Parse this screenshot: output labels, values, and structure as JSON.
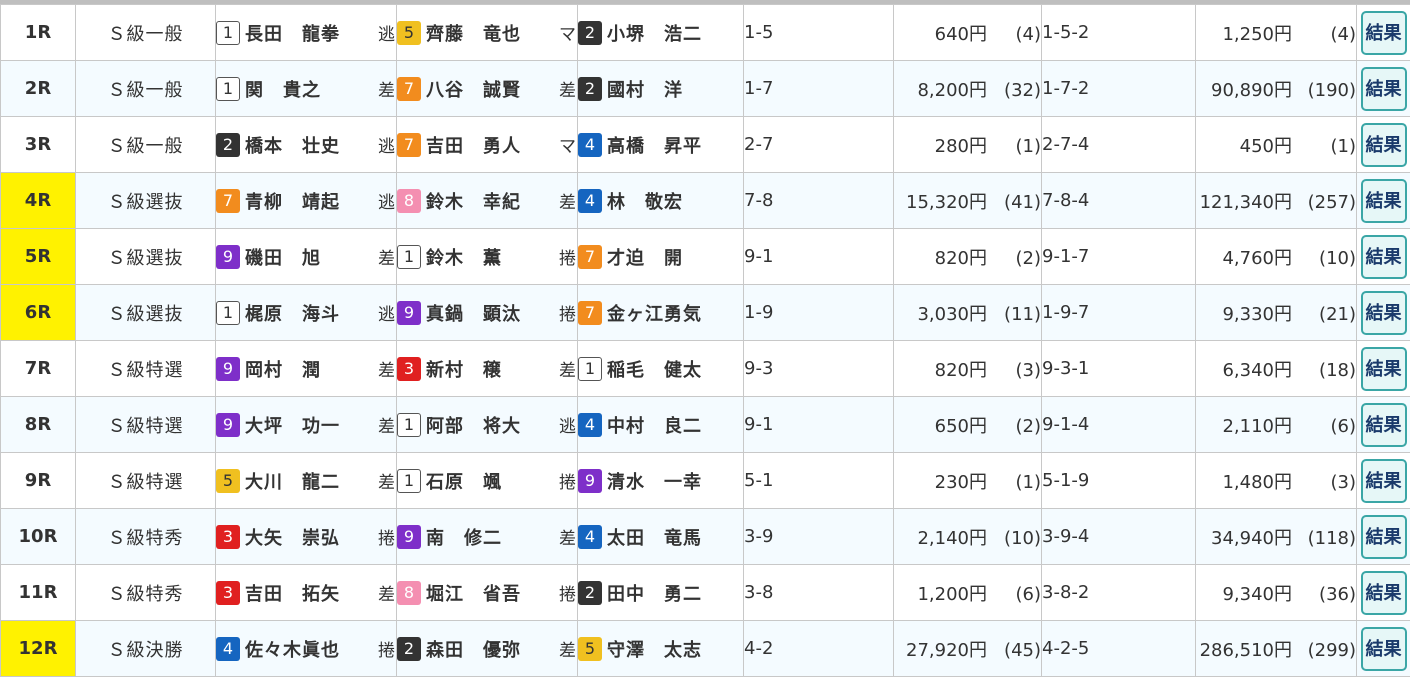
{
  "button_label": "結果",
  "car_colors": {
    "1": "#ffffff",
    "2": "#333333",
    "3": "#e02020",
    "4": "#1565c0",
    "5": "#f0c020",
    "6": "#2e7d32",
    "7": "#f28c1e",
    "8": "#f48fb1",
    "9": "#7e2fc9"
  },
  "highlight_color": "#fff200",
  "races": [
    {
      "race": "1R",
      "highlight": false,
      "grade": "Ｓ級一般",
      "first": {
        "car": "1",
        "name": "長田　龍拳",
        "tactic": "逃"
      },
      "second": {
        "car": "5",
        "name": "齊藤　竜也",
        "tactic": "マ"
      },
      "third": {
        "car": "2",
        "name": "小堺　浩二"
      },
      "exacta": "1-5",
      "exacta_pay": "640円",
      "exacta_pop": "(4)",
      "trifecta": "1-5-2",
      "trifecta_pay": "1,250円",
      "trifecta_pop": "(4)"
    },
    {
      "race": "2R",
      "highlight": false,
      "grade": "Ｓ級一般",
      "first": {
        "car": "1",
        "name": "関　貴之",
        "tactic": "差"
      },
      "second": {
        "car": "7",
        "name": "八谷　誠賢",
        "tactic": "差"
      },
      "third": {
        "car": "2",
        "name": "國村　洋"
      },
      "exacta": "1-7",
      "exacta_pay": "8,200円",
      "exacta_pop": "(32)",
      "trifecta": "1-7-2",
      "trifecta_pay": "90,890円",
      "trifecta_pop": "(190)"
    },
    {
      "race": "3R",
      "highlight": false,
      "grade": "Ｓ級一般",
      "first": {
        "car": "2",
        "name": "橋本　壮史",
        "tactic": "逃"
      },
      "second": {
        "car": "7",
        "name": "吉田　勇人",
        "tactic": "マ"
      },
      "third": {
        "car": "4",
        "name": "高橋　昇平"
      },
      "exacta": "2-7",
      "exacta_pay": "280円",
      "exacta_pop": "(1)",
      "trifecta": "2-7-4",
      "trifecta_pay": "450円",
      "trifecta_pop": "(1)"
    },
    {
      "race": "4R",
      "highlight": true,
      "grade": "Ｓ級選抜",
      "first": {
        "car": "7",
        "name": "青柳　靖起",
        "tactic": "逃"
      },
      "second": {
        "car": "8",
        "name": "鈴木　幸紀",
        "tactic": "差"
      },
      "third": {
        "car": "4",
        "name": "林　敬宏"
      },
      "exacta": "7-8",
      "exacta_pay": "15,320円",
      "exacta_pop": "(41)",
      "trifecta": "7-8-4",
      "trifecta_pay": "121,340円",
      "trifecta_pop": "(257)"
    },
    {
      "race": "5R",
      "highlight": true,
      "grade": "Ｓ級選抜",
      "first": {
        "car": "9",
        "name": "磯田　旭",
        "tactic": "差"
      },
      "second": {
        "car": "1",
        "name": "鈴木　薫",
        "tactic": "捲"
      },
      "third": {
        "car": "7",
        "name": "才迫　開"
      },
      "exacta": "9-1",
      "exacta_pay": "820円",
      "exacta_pop": "(2)",
      "trifecta": "9-1-7",
      "trifecta_pay": "4,760円",
      "trifecta_pop": "(10)"
    },
    {
      "race": "6R",
      "highlight": true,
      "grade": "Ｓ級選抜",
      "first": {
        "car": "1",
        "name": "梶原　海斗",
        "tactic": "逃"
      },
      "second": {
        "car": "9",
        "name": "真鍋　顕汰",
        "tactic": "捲"
      },
      "third": {
        "car": "7",
        "name": "金ヶ江勇気"
      },
      "exacta": "1-9",
      "exacta_pay": "3,030円",
      "exacta_pop": "(11)",
      "trifecta": "1-9-7",
      "trifecta_pay": "9,330円",
      "trifecta_pop": "(21)"
    },
    {
      "race": "7R",
      "highlight": false,
      "grade": "Ｓ級特選",
      "first": {
        "car": "9",
        "name": "岡村　潤",
        "tactic": "差"
      },
      "second": {
        "car": "3",
        "name": "新村　穣",
        "tactic": "差"
      },
      "third": {
        "car": "1",
        "name": "稲毛　健太"
      },
      "exacta": "9-3",
      "exacta_pay": "820円",
      "exacta_pop": "(3)",
      "trifecta": "9-3-1",
      "trifecta_pay": "6,340円",
      "trifecta_pop": "(18)"
    },
    {
      "race": "8R",
      "highlight": false,
      "grade": "Ｓ級特選",
      "first": {
        "car": "9",
        "name": "大坪　功一",
        "tactic": "差"
      },
      "second": {
        "car": "1",
        "name": "阿部　将大",
        "tactic": "逃"
      },
      "third": {
        "car": "4",
        "name": "中村　良二"
      },
      "exacta": "9-1",
      "exacta_pay": "650円",
      "exacta_pop": "(2)",
      "trifecta": "9-1-4",
      "trifecta_pay": "2,110円",
      "trifecta_pop": "(6)"
    },
    {
      "race": "9R",
      "highlight": false,
      "grade": "Ｓ級特選",
      "first": {
        "car": "5",
        "name": "大川　龍二",
        "tactic": "差"
      },
      "second": {
        "car": "1",
        "name": "石原　颯",
        "tactic": "捲"
      },
      "third": {
        "car": "9",
        "name": "清水　一幸"
      },
      "exacta": "5-1",
      "exacta_pay": "230円",
      "exacta_pop": "(1)",
      "trifecta": "5-1-9",
      "trifecta_pay": "1,480円",
      "trifecta_pop": "(3)"
    },
    {
      "race": "10R",
      "highlight": false,
      "grade": "Ｓ級特秀",
      "first": {
        "car": "3",
        "name": "大矢　崇弘",
        "tactic": "捲"
      },
      "second": {
        "car": "9",
        "name": "南　修二",
        "tactic": "差"
      },
      "third": {
        "car": "4",
        "name": "太田　竜馬"
      },
      "exacta": "3-9",
      "exacta_pay": "2,140円",
      "exacta_pop": "(10)",
      "trifecta": "3-9-4",
      "trifecta_pay": "34,940円",
      "trifecta_pop": "(118)"
    },
    {
      "race": "11R",
      "highlight": false,
      "grade": "Ｓ級特秀",
      "first": {
        "car": "3",
        "name": "吉田　拓矢",
        "tactic": "差"
      },
      "second": {
        "car": "8",
        "name": "堀江　省吾",
        "tactic": "捲"
      },
      "third": {
        "car": "2",
        "name": "田中　勇二"
      },
      "exacta": "3-8",
      "exacta_pay": "1,200円",
      "exacta_pop": "(6)",
      "trifecta": "3-8-2",
      "trifecta_pay": "9,340円",
      "trifecta_pop": "(36)"
    },
    {
      "race": "12R",
      "highlight": true,
      "grade": "Ｓ級決勝",
      "first": {
        "car": "4",
        "name": "佐々木眞也",
        "tactic": "捲"
      },
      "second": {
        "car": "2",
        "name": "森田　優弥",
        "tactic": "差"
      },
      "third": {
        "car": "5",
        "name": "守澤　太志"
      },
      "exacta": "4-2",
      "exacta_pay": "27,920円",
      "exacta_pop": "(45)",
      "trifecta": "4-2-5",
      "trifecta_pay": "286,510円",
      "trifecta_pop": "(299)"
    }
  ]
}
